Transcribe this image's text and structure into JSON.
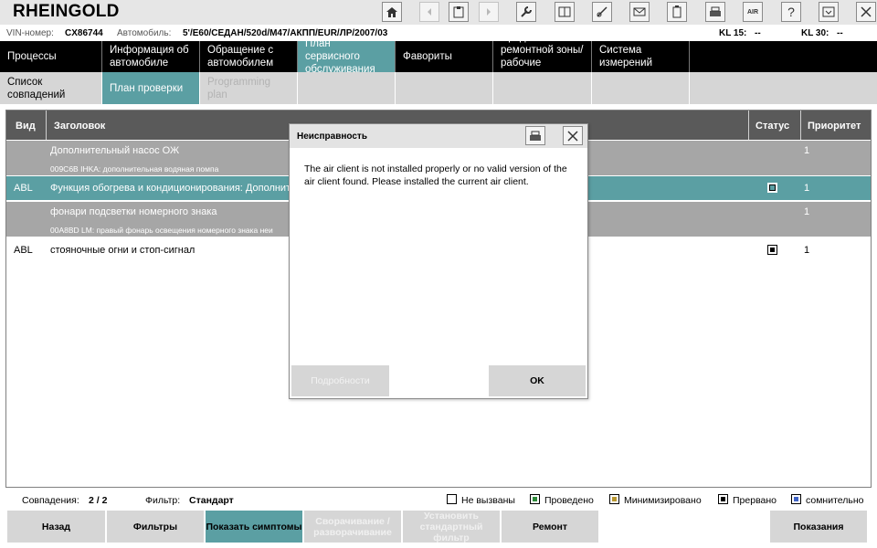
{
  "app": {
    "title": "RHEINGOLD"
  },
  "toolbar": {
    "icons": [
      "home-icon",
      "back-icon",
      "clipboard-icon",
      "forward-icon",
      "wrench-icon",
      "data-icon",
      "gauge-icon",
      "mail-icon",
      "battery-icon",
      "print-icon",
      "air-icon",
      "help-icon",
      "minimize-icon",
      "close-icon"
    ],
    "help_label": "?",
    "air_label": "AIR"
  },
  "vehicle": {
    "vin_label": "VIN-номер:",
    "vin_value": "CX86744",
    "car_label": "Автомобиль:",
    "car_value": "5'/E60/СЕДАН/520d/M47/АКПП/EUR/ЛР/2007/03",
    "kl15_label": "KL 15:",
    "kl15_value": "--",
    "kl30_label": "KL 30:",
    "kl30_value": "--"
  },
  "nav": {
    "tabs": [
      "Процессы",
      "Информация об автомобиле",
      "Обращение с автомобилем",
      "План сервисного обслуживания",
      "Фавориты",
      "Средства ремонтной зоны/ рабочие жидкости",
      "Система измерений"
    ]
  },
  "subnav": {
    "tabs": [
      "Список совпадений",
      "План проверки",
      "Programming plan"
    ]
  },
  "table": {
    "headers": {
      "kind": "Вид",
      "title": "Заголовок",
      "status": "Статус",
      "priority": "Приоритет"
    },
    "rows": [
      {
        "kind": "",
        "title": "Дополнительный насос ОЖ",
        "subtitle": "009C6B  IHKA: дополнительная водяная помпа",
        "priority": "1"
      },
      {
        "kind": "ABL",
        "title": "Функция обогрева и кондиционирования: Дополнител",
        "subtitle": "",
        "priority": "1"
      },
      {
        "kind": "",
        "title": "фонари подсветки номерного знака",
        "subtitle": "00A8BD  LM: правый фонарь освещения номерного знака неи",
        "priority": "1"
      },
      {
        "kind": "ABL",
        "title": "стояночные огни и стоп-сигнал",
        "subtitle": "",
        "priority": "1"
      }
    ]
  },
  "statusbar": {
    "matches_label": "Совпадения:",
    "matches_value": "2 / 2",
    "filter_label": "Фильтр:",
    "filter_value": "Стандарт",
    "legend": [
      {
        "label": "Не вызваны",
        "color": "#ffffff"
      },
      {
        "label": "Проведено",
        "color": "#2e8b3a"
      },
      {
        "label": "Минимизировано",
        "color": "#b8962e"
      },
      {
        "label": "Прервано",
        "color": "#000000"
      },
      {
        "label": "сомнительно",
        "color": "#3f63c6"
      }
    ]
  },
  "buttons": {
    "back": "Назад",
    "filters": "Фильтры",
    "show_symptoms": "Показать симптомы",
    "collapse": "Сворачивание / разворачивание",
    "set_filter": "Установить стандартный фильтр",
    "repair": "Ремонт",
    "readings": "Показания"
  },
  "dialog": {
    "title": "Неисправность",
    "message": "The air client is not installed properly or no valid version of the air client found. Please installed the current air client.",
    "details_button": "Подробности",
    "ok_button": "OK"
  },
  "colors": {
    "accent": "#5b9fa3",
    "header_bg": "#5a5a5a",
    "nav_bg": "#000000",
    "row_grey": "#a6a6a6"
  }
}
